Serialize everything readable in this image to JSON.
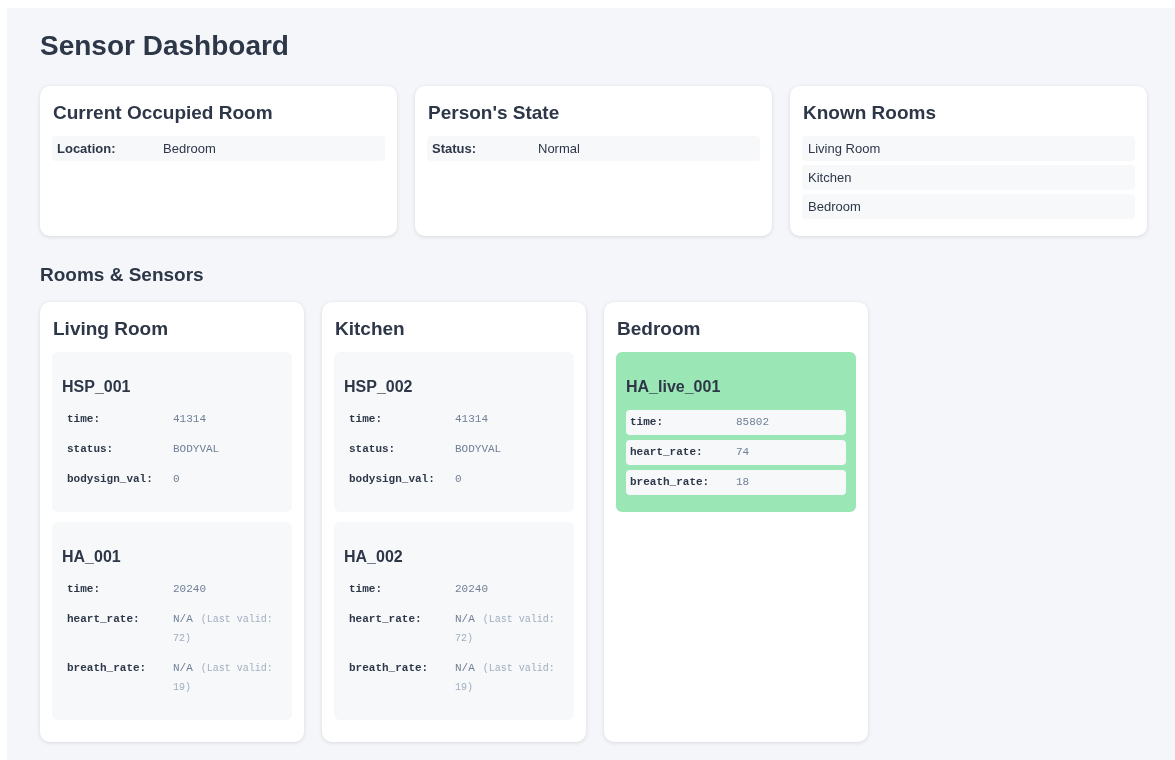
{
  "title": "Sensor Dashboard",
  "summary_cards": [
    {
      "kind": "fields",
      "title": "Current Occupied Room",
      "fields": [
        {
          "label": "Location:",
          "value": "Bedroom"
        }
      ]
    },
    {
      "kind": "fields",
      "title": "Person's State",
      "fields": [
        {
          "label": "Status:",
          "value": "Normal"
        }
      ]
    },
    {
      "kind": "list",
      "title": "Known Rooms",
      "items": [
        "Living Room",
        "Kitchen",
        "Bedroom"
      ]
    }
  ],
  "rooms_heading": "Rooms & Sensors",
  "rooms": [
    {
      "name": "Living Room",
      "sensors": [
        {
          "name": "HSP_001",
          "active": false,
          "readings": [
            {
              "label": "time:",
              "value": "41314"
            },
            {
              "label": "status:",
              "value": "BODYVAL"
            },
            {
              "label": "bodysign_val:",
              "value": "0"
            }
          ]
        },
        {
          "name": "HA_001",
          "active": false,
          "readings": [
            {
              "label": "time:",
              "value": "20240"
            },
            {
              "label": "heart_rate:",
              "value": "N/A",
              "note": "(Last valid: 72)"
            },
            {
              "label": "breath_rate:",
              "value": "N/A",
              "note": "(Last valid: 19)"
            }
          ]
        }
      ]
    },
    {
      "name": "Kitchen",
      "sensors": [
        {
          "name": "HSP_002",
          "active": false,
          "readings": [
            {
              "label": "time:",
              "value": "41314"
            },
            {
              "label": "status:",
              "value": "BODYVAL"
            },
            {
              "label": "bodysign_val:",
              "value": "0"
            }
          ]
        },
        {
          "name": "HA_002",
          "active": false,
          "readings": [
            {
              "label": "time:",
              "value": "20240"
            },
            {
              "label": "heart_rate:",
              "value": "N/A",
              "note": "(Last valid: 72)"
            },
            {
              "label": "breath_rate:",
              "value": "N/A",
              "note": "(Last valid: 19)"
            }
          ]
        }
      ]
    },
    {
      "name": "Bedroom",
      "sensors": [
        {
          "name": "HA_live_001",
          "active": true,
          "readings": [
            {
              "label": "time:",
              "value": "85802"
            },
            {
              "label": "heart_rate:",
              "value": "74"
            },
            {
              "label": "breath_rate:",
              "value": "18"
            }
          ]
        }
      ]
    }
  ]
}
